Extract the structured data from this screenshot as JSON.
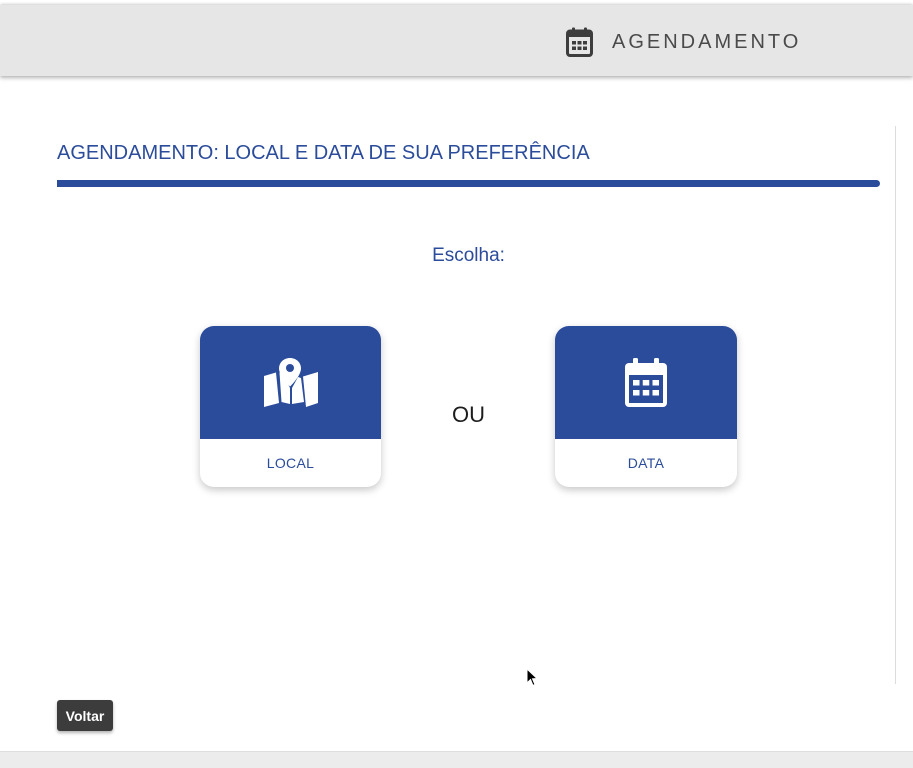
{
  "header": {
    "title": "AGENDAMENTO",
    "icon": "calendar-icon"
  },
  "main": {
    "section_title": "AGENDAMENTO: LOCAL E DATA DE SUA PREFERÊNCIA",
    "choose_label": "Escolha:",
    "or_label": "OU",
    "options": [
      {
        "label": "LOCAL",
        "icon": "map-pin-icon"
      },
      {
        "label": "DATA",
        "icon": "calendar-icon"
      }
    ]
  },
  "footer": {
    "back_label": "Voltar"
  },
  "colors": {
    "primary": "#2a4c9b",
    "header_bg": "#e6e6e6",
    "button_bg": "#3c3c3c",
    "text_dark": "#1d1d1d"
  }
}
